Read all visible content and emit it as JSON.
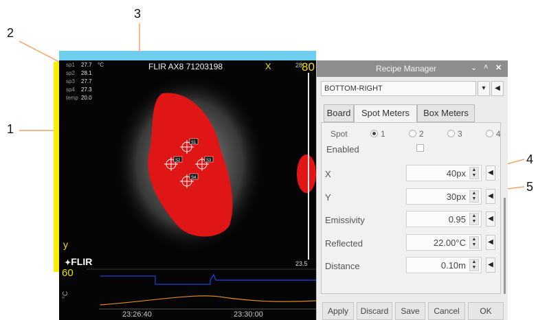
{
  "callouts": [
    "1",
    "2",
    "3",
    "4",
    "5"
  ],
  "thermal": {
    "camera_title": "FLIR AX8 71203198",
    "unit": "°C",
    "spot_readings": [
      {
        "label": "sp1",
        "value": "27.7"
      },
      {
        "label": "sp2",
        "value": "28.1"
      },
      {
        "label": "sp3",
        "value": "27.7"
      },
      {
        "label": "sp4",
        "value": "27.3"
      },
      {
        "label": "temp",
        "value": "20.0"
      }
    ],
    "x_marker": "X",
    "y_marker": "y",
    "scale_top_small": "28",
    "scale_top": "80",
    "scale_bottom": "60",
    "scale_value": "23.5",
    "logo": "FLIR",
    "graph_axis_unit": "°C",
    "time_labels": [
      "23:26:40",
      "23:30:00"
    ],
    "spot_tags": [
      "S1",
      "S2",
      "S3",
      "S4"
    ]
  },
  "dialog": {
    "title": "Recipe Manager",
    "titlebar_icons": [
      "chevron-down-icon",
      "chevron-up-icon",
      "close-icon"
    ],
    "recipe_value": "BOTTOM-RIGHT",
    "tabs": [
      "Board",
      "Spot Meters",
      "Box Meters"
    ],
    "active_tab": "Spot Meters",
    "spot_label": "Spot",
    "spot_options": [
      "1",
      "2",
      "3",
      "4"
    ],
    "selected_spot": "1",
    "enabled_label": "Enabled",
    "fields": [
      {
        "label": "X",
        "value": "40px"
      },
      {
        "label": "Y",
        "value": "30px"
      },
      {
        "label": "Emissivity",
        "value": "0.95"
      },
      {
        "label": "Reflected",
        "value": "22.00°C"
      },
      {
        "label": "Distance",
        "value": "0.10m"
      }
    ],
    "buttons": [
      "Apply",
      "Discard",
      "Save",
      "Cancel",
      "OK"
    ]
  },
  "colors": {
    "annotation_line": "#f4a261",
    "y_axis_bar": "#ffee00",
    "top_bar": "#6fcdf0",
    "hot_region": "#e01515",
    "graph_blue": "#2244dd",
    "graph_orange": "#e08a1e"
  }
}
